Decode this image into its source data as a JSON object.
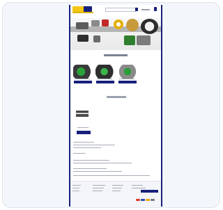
{
  "page": {
    "background": "#f3f6fb",
    "accent": "#17207a",
    "brand_yellow": "#f3c611"
  },
  "header": {
    "icons": [
      "search-icon",
      "cart-icon"
    ]
  }
}
